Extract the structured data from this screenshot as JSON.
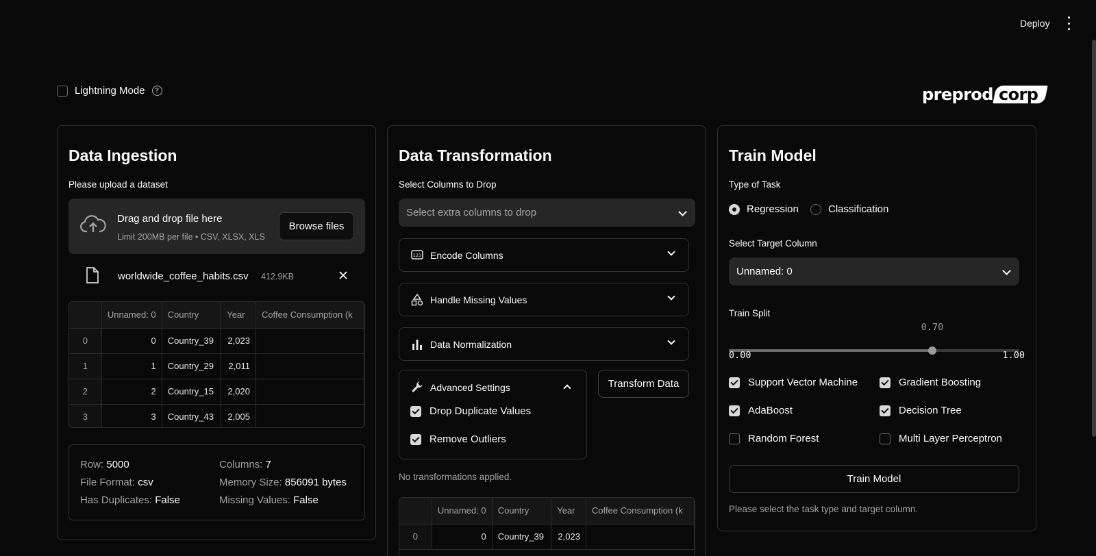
{
  "header": {
    "deploy_label": "Deploy"
  },
  "lightning_mode": {
    "label": "Lightning Mode",
    "checked": false
  },
  "logo": {
    "part1": "preprod",
    "part2": "corp"
  },
  "ingestion": {
    "title": "Data Ingestion",
    "upload_label": "Please upload a dataset",
    "uploader": {
      "title": "Drag and drop file here",
      "subtitle": "Limit 200MB per file • CSV, XLSX, XLS",
      "browse_label": "Browse files"
    },
    "file": {
      "name": "worldwide_coffee_habits.csv",
      "size": "412.9KB"
    },
    "table": {
      "columns": [
        "Unnamed: 0",
        "Country",
        "Year",
        "Coffee Consumption (k"
      ],
      "rows": [
        [
          "0",
          "0",
          "Country_39",
          "2,023",
          ""
        ],
        [
          "1",
          "1",
          "Country_29",
          "2,011",
          ""
        ],
        [
          "2",
          "2",
          "Country_15",
          "2,020",
          ""
        ],
        [
          "3",
          "3",
          "Country_43",
          "2,005",
          ""
        ]
      ]
    },
    "stats": {
      "row_label": "Row:",
      "row_value": "5000",
      "columns_label": "Columns:",
      "columns_value": "7",
      "format_label": "File Format:",
      "format_value": "csv",
      "memory_label": "Memory Size:",
      "memory_value": "856091 bytes",
      "dup_label": "Has Duplicates:",
      "dup_value": "False",
      "missing_label": "Missing Values:",
      "missing_value": "False"
    }
  },
  "transformation": {
    "title": "Data Transformation",
    "drop_label": "Select Columns to Drop",
    "drop_placeholder": "Select extra columns to drop",
    "expanders": [
      {
        "label": "Encode Columns",
        "icon": "encode-icon"
      },
      {
        "label": "Handle Missing Values",
        "icon": "shapes-icon"
      },
      {
        "label": "Data Normalization",
        "icon": "bar-chart-icon"
      }
    ],
    "advanced": {
      "label": "Advanced Settings",
      "options": [
        {
          "label": "Drop Duplicate Values",
          "checked": true
        },
        {
          "label": "Remove Outliers",
          "checked": true
        }
      ]
    },
    "transform_button": "Transform Data",
    "status": "No transformations applied.",
    "table": {
      "columns": [
        "Unnamed: 0",
        "Country",
        "Year",
        "Coffee Consumption (k"
      ],
      "rows": [
        [
          "0",
          "0",
          "Country_39",
          "2,023",
          ""
        ]
      ]
    }
  },
  "train": {
    "title": "Train Model",
    "task_label": "Type of Task",
    "tasks": [
      {
        "label": "Regression",
        "selected": true
      },
      {
        "label": "Classification",
        "selected": false
      }
    ],
    "target_label": "Select Target Column",
    "target_value": "Unnamed: 0",
    "split_label": "Train Split",
    "split": {
      "value": 0.7,
      "value_label": "0.70",
      "min_label": "0.00",
      "max_label": "1.00",
      "min": 0,
      "max": 1
    },
    "models": [
      {
        "label": "Support Vector Machine",
        "checked": true
      },
      {
        "label": "Gradient Boosting",
        "checked": true
      },
      {
        "label": "AdaBoost",
        "checked": true
      },
      {
        "label": "Decision Tree",
        "checked": true
      },
      {
        "label": "Random Forest",
        "checked": false
      },
      {
        "label": "Multi Layer Perceptron",
        "checked": false
      }
    ],
    "train_button": "Train Model",
    "hint": "Please select the task type and target column."
  }
}
